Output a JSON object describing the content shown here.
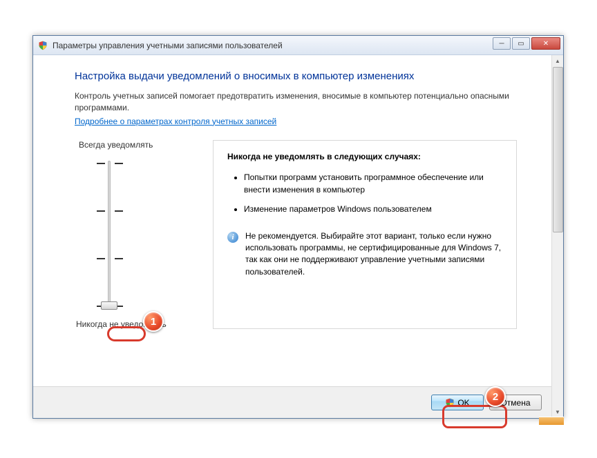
{
  "window": {
    "title": "Параметры управления учетными записями пользователей"
  },
  "page": {
    "heading": "Настройка выдачи уведомлений о вносимых в компьютер изменениях",
    "intro": "Контроль учетных записей помогает предотвратить изменения, вносимые в компьютер потенциально опасными программами.",
    "learn_more": "Подробнее о параметрах контроля учетных записей"
  },
  "slider": {
    "top_label": "Всегда уведомлять",
    "bottom_label": "Никогда не уведомлять",
    "position": 3,
    "levels": 4
  },
  "description": {
    "heading": "Никогда не уведомлять в следующих случаях:",
    "bullets": [
      "Попытки программ установить программное обеспечение или внести изменения в компьютер",
      "Изменение параметров Windows пользователем"
    ],
    "warning": "Не рекомендуется. Выбирайте этот вариант, только если нужно использовать программы, не сертифицированные для Windows 7, так как они не поддерживают управление учетными записями пользователей."
  },
  "buttons": {
    "ok": "OK",
    "cancel": "Отмена"
  },
  "annotations": {
    "badge1": "1",
    "badge2": "2"
  }
}
